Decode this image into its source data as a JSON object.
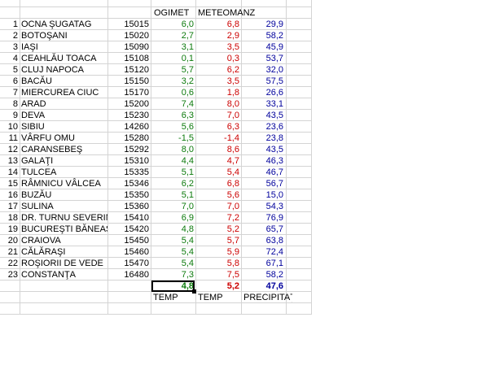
{
  "headers": {
    "ogimet": "OGIMET",
    "meteomanz": "METEOMANZ"
  },
  "rows": [
    {
      "idx": "1",
      "name": "OCNA ŞUGATAG",
      "code": "15015",
      "ogimet": "6,0",
      "meteomanz": "6,8",
      "precip": "29,9"
    },
    {
      "idx": "2",
      "name": "BOTOŞANI",
      "code": "15020",
      "ogimet": "2,7",
      "meteomanz": "2,9",
      "precip": "58,2"
    },
    {
      "idx": "3",
      "name": "IAŞI",
      "code": "15090",
      "ogimet": "3,1",
      "meteomanz": "3,5",
      "precip": "45,9"
    },
    {
      "idx": "4",
      "name": "CEAHLĂU TOACA",
      "code": "15108",
      "ogimet": "0,1",
      "meteomanz": "0,3",
      "precip": "53,7"
    },
    {
      "idx": "5",
      "name": "CLUJ NAPOCA",
      "code": "15120",
      "ogimet": "5,7",
      "meteomanz": "6,2",
      "precip": "32,0"
    },
    {
      "idx": "6",
      "name": "BACĂU",
      "code": "15150",
      "ogimet": "3,2",
      "meteomanz": "3,5",
      "precip": "57,5"
    },
    {
      "idx": "7",
      "name": "MIERCUREA CIUC",
      "code": "15170",
      "ogimet": "0,6",
      "meteomanz": "1,8",
      "precip": "26,6"
    },
    {
      "idx": "8",
      "name": "ARAD",
      "code": "15200",
      "ogimet": "7,4",
      "meteomanz": "8,0",
      "precip": "33,1"
    },
    {
      "idx": "9",
      "name": "DEVA",
      "code": "15230",
      "ogimet": "6,3",
      "meteomanz": "7,0",
      "precip": "43,5"
    },
    {
      "idx": "10",
      "name": "SIBIU",
      "code": "14260",
      "ogimet": "5,6",
      "meteomanz": "6,3",
      "precip": "23,6"
    },
    {
      "idx": "11",
      "name": "VÂRFU OMU",
      "code": "15280",
      "ogimet": "-1,5",
      "meteomanz": "-1,4",
      "precip": "23,8"
    },
    {
      "idx": "12",
      "name": "CARANSEBEŞ",
      "code": "15292",
      "ogimet": "8,0",
      "meteomanz": "8,6",
      "precip": "43,5"
    },
    {
      "idx": "13",
      "name": "GALAŢI",
      "code": "15310",
      "ogimet": "4,4",
      "meteomanz": "4,7",
      "precip": "46,3"
    },
    {
      "idx": "14",
      "name": "TULCEA",
      "code": "15335",
      "ogimet": "5,1",
      "meteomanz": "5,4",
      "precip": "46,7"
    },
    {
      "idx": "15",
      "name": "RÂMNICU VÂLCEA",
      "code": "15346",
      "ogimet": "6,2",
      "meteomanz": "6,8",
      "precip": "56,7"
    },
    {
      "idx": "16",
      "name": "BUZĂU",
      "code": "15350",
      "ogimet": "5,1",
      "meteomanz": "5,6",
      "precip": "15,0"
    },
    {
      "idx": "17",
      "name": "SULINA",
      "code": "15360",
      "ogimet": "7,0",
      "meteomanz": "7,0",
      "precip": "54,3"
    },
    {
      "idx": "18",
      "name": "DR. TURNU SEVERIN",
      "code": "15410",
      "ogimet": "6,9",
      "meteomanz": "7,2",
      "precip": "76,9"
    },
    {
      "idx": "19",
      "name": "BUCUREŞTI BĂNEASA",
      "code": "15420",
      "ogimet": "4,8",
      "meteomanz": "5,2",
      "precip": "65,7"
    },
    {
      "idx": "20",
      "name": "CRAIOVA",
      "code": "15450",
      "ogimet": "5,4",
      "meteomanz": "5,7",
      "precip": "63,8"
    },
    {
      "idx": "21",
      "name": "CĂLĂRAŞI",
      "code": "15460",
      "ogimet": "5,4",
      "meteomanz": "5,9",
      "precip": "72,4"
    },
    {
      "idx": "22",
      "name": "ROŞIORII DE VEDE",
      "code": "15470",
      "ogimet": "5,4",
      "meteomanz": "5,8",
      "precip": "67,1"
    },
    {
      "idx": "23",
      "name": "CONSTANŢA",
      "code": "16480",
      "ogimet": "7,3",
      "meteomanz": "7,5",
      "precip": "58,2"
    }
  ],
  "totals": {
    "ogimet": "4,8",
    "meteomanz": "5,2",
    "precip": "47,6"
  },
  "footer": {
    "ogimet": "TEMP",
    "meteomanz": "TEMP",
    "precip": "PRECIPITAŢII"
  },
  "colors": {
    "ogimet": "#0c7a0c",
    "meteomanz": "#cc0000",
    "precip": "#00009c",
    "grid": "#d4d4d4"
  }
}
